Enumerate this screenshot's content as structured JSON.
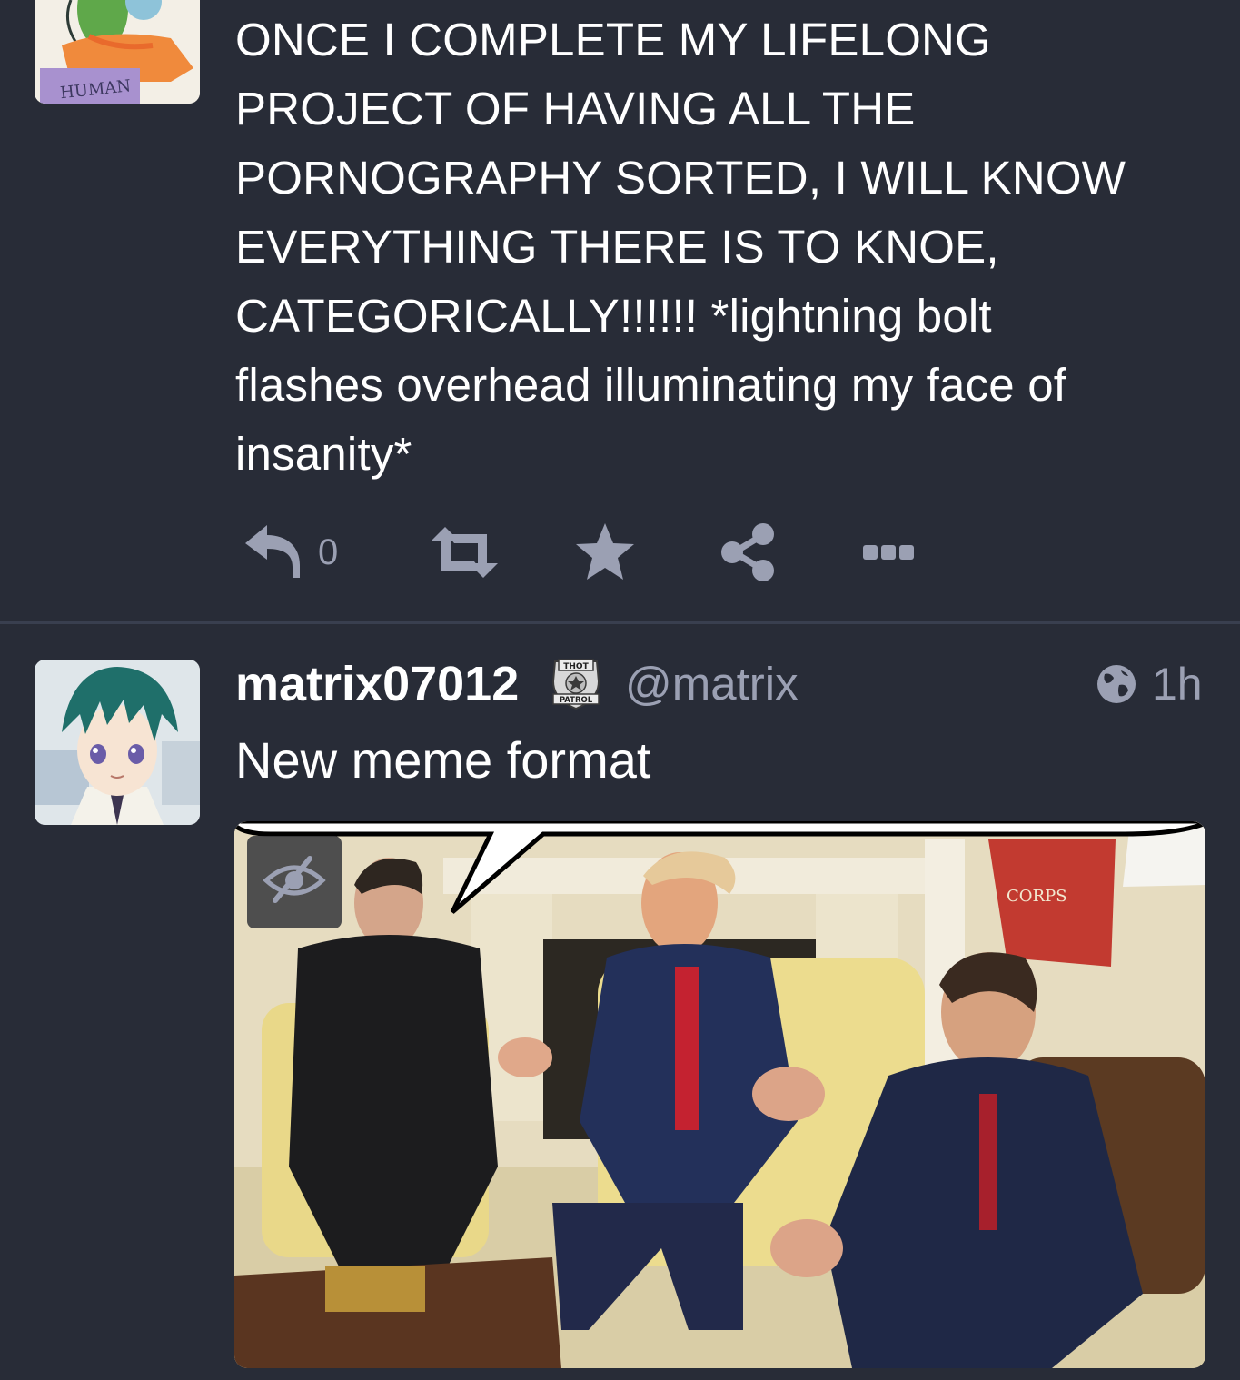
{
  "post1": {
    "avatar_label": "HUMAN",
    "text": "ONCE I COMPLETE MY LIFELONG\nPROJECT OF HAVING ALL THE\nPORNOGRAPHY SORTED, I WILL KNOW\nEVERYTHING THERE IS TO KNOE,\nCATEGORICALLY!!!!!! *lightning bolt\nflashes overhead illuminating my face of\ninsanity*",
    "reply_count": "0",
    "actions": [
      "reply-icon",
      "boost-icon",
      "favourite-icon",
      "share-icon",
      "more-icon"
    ]
  },
  "post2": {
    "display_name": "matrix07012",
    "badge_text_top": "THOT",
    "badge_text_bottom": "PATROL",
    "handle": "@matrix",
    "visibility_icon": "globe-icon",
    "timestamp": "1h",
    "text": "New meme format",
    "media_flag_text": "CORPS",
    "media_hide_icon": "eye-slash-icon"
  },
  "colors": {
    "background": "#282c37",
    "divider": "#393f4f",
    "text": "#ffffff",
    "muted": "#9ba0b3"
  }
}
